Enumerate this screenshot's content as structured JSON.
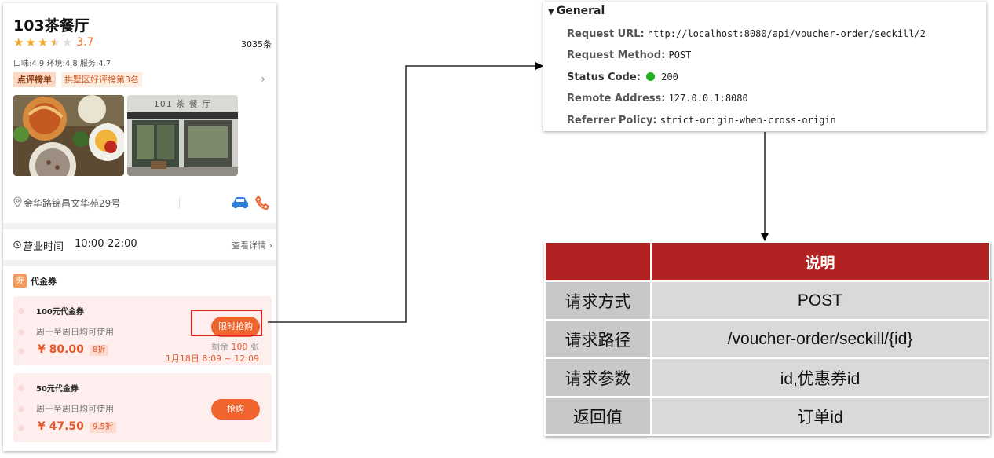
{
  "shop": {
    "name": "103茶餐厅",
    "rating": "3.7",
    "stars_filled": 3.5,
    "reviews": "3035条",
    "scores": "口味:4.9 环境:4.8 服务:4.7",
    "rank_badge": "点评榜单",
    "rank_text": "拱墅区好评榜第3名",
    "photo_sign": "101 茶 餐 厅",
    "address": "金华路锦昌文华苑29号",
    "hours_label": "营业时间",
    "hours_value": "10:00-22:00",
    "details_link": "查看详情"
  },
  "coupons": {
    "badge": "券",
    "title": "代金券",
    "items": [
      {
        "name": "100元代金券",
        "desc": "周一至周日均可使用",
        "price": "¥ 80.00",
        "discount": "8折",
        "button": "限时抢购",
        "remain_prefix": "剩余",
        "remain_num": "100",
        "remain_suffix": "张",
        "time": "1月18日 8:09 ~ 12:09"
      },
      {
        "name": "50元代金券",
        "desc": "周一至周日均可使用",
        "price": "¥ 47.50",
        "discount": "9.5折",
        "button": "抢购"
      }
    ]
  },
  "general": {
    "title": "General",
    "rows": [
      {
        "key": "Request URL:",
        "value": "http://localhost:8080/api/voucher-order/seckill/2"
      },
      {
        "key": "Request Method:",
        "value": "POST"
      },
      {
        "key": "Status Code:",
        "value": "200"
      },
      {
        "key": "Remote Address:",
        "value": "127.0.0.1:8080"
      },
      {
        "key": "Referrer Policy:",
        "value": "strict-origin-when-cross-origin"
      }
    ]
  },
  "api_table": {
    "header": [
      "",
      "说明"
    ],
    "rows": [
      [
        "请求方式",
        "POST"
      ],
      [
        "请求路径",
        "/voucher-order/seckill/{id}"
      ],
      [
        "请求参数",
        "id,优惠券id"
      ],
      [
        "返回值",
        "订单id"
      ]
    ]
  },
  "colors": {
    "accent": "#f0652e",
    "table_header": "#b22222",
    "highlight": "#e01e1e"
  }
}
